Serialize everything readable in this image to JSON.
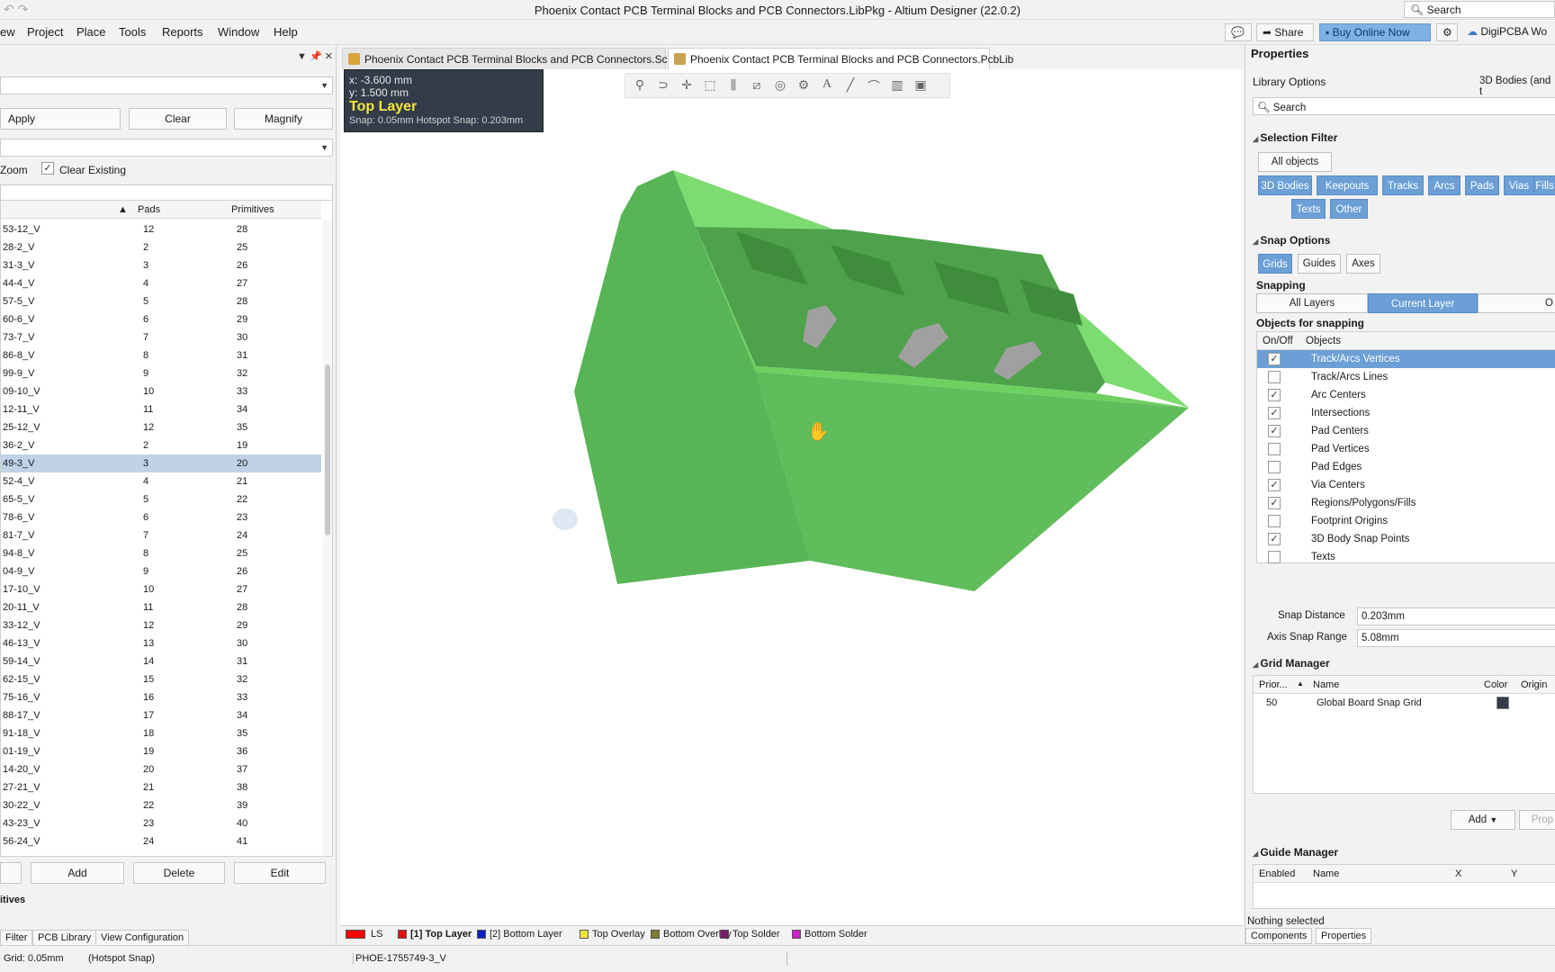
{
  "app": {
    "title": "Phoenix Contact PCB Terminal Blocks and PCB Connectors.LibPkg - Altium Designer (22.0.2)",
    "search_placeholder": "Search"
  },
  "menu": [
    "ew",
    "Project",
    "Place",
    "Tools",
    "Reports",
    "Window",
    "Help"
  ],
  "topbar": {
    "share": "Share",
    "buy": "Buy Online Now",
    "digipcba": "DigiPCBA Wo"
  },
  "left": {
    "apply": "Apply",
    "clear": "Clear",
    "magnify": "Magnify",
    "zoom": "Zoom",
    "clear_existing": "Clear Existing",
    "col_pads": "Pads",
    "col_primitives": "Primitives",
    "rows": [
      [
        "53-12_V",
        "12",
        "28"
      ],
      [
        "28-2_V",
        "2",
        "25"
      ],
      [
        "31-3_V",
        "3",
        "26"
      ],
      [
        "44-4_V",
        "4",
        "27"
      ],
      [
        "57-5_V",
        "5",
        "28"
      ],
      [
        "60-6_V",
        "6",
        "29"
      ],
      [
        "73-7_V",
        "7",
        "30"
      ],
      [
        "86-8_V",
        "8",
        "31"
      ],
      [
        "99-9_V",
        "9",
        "32"
      ],
      [
        "09-10_V",
        "10",
        "33"
      ],
      [
        "12-11_V",
        "11",
        "34"
      ],
      [
        "25-12_V",
        "12",
        "35"
      ],
      [
        "36-2_V",
        "2",
        "19"
      ],
      [
        "49-3_V",
        "3",
        "20"
      ],
      [
        "52-4_V",
        "4",
        "21"
      ],
      [
        "65-5_V",
        "5",
        "22"
      ],
      [
        "78-6_V",
        "6",
        "23"
      ],
      [
        "81-7_V",
        "7",
        "24"
      ],
      [
        "94-8_V",
        "8",
        "25"
      ],
      [
        "04-9_V",
        "9",
        "26"
      ],
      [
        "17-10_V",
        "10",
        "27"
      ],
      [
        "20-11_V",
        "11",
        "28"
      ],
      [
        "33-12_V",
        "12",
        "29"
      ],
      [
        "46-13_V",
        "13",
        "30"
      ],
      [
        "59-14_V",
        "14",
        "31"
      ],
      [
        "62-15_V",
        "15",
        "32"
      ],
      [
        "75-16_V",
        "16",
        "33"
      ],
      [
        "88-17_V",
        "17",
        "34"
      ],
      [
        "91-18_V",
        "18",
        "35"
      ],
      [
        "01-19_V",
        "19",
        "36"
      ],
      [
        "14-20_V",
        "20",
        "37"
      ],
      [
        "27-21_V",
        "21",
        "38"
      ],
      [
        "30-22_V",
        "22",
        "39"
      ],
      [
        "43-23_V",
        "23",
        "40"
      ],
      [
        "56-24_V",
        "24",
        "41"
      ]
    ],
    "selected_row": 13,
    "add": "Add",
    "delete": "Delete",
    "edit": "Edit",
    "primitives": "itives",
    "tabs": [
      "Filter",
      "PCB Library",
      "View Configuration"
    ]
  },
  "doc_tabs": [
    {
      "label": "Phoenix Contact PCB Terminal Blocks and PCB Connectors.SchLib",
      "icon_color": "#d9a53a"
    },
    {
      "label": "Phoenix Contact PCB Terminal Blocks and PCB Connectors.PcbLib",
      "icon_color": "#c8a050"
    }
  ],
  "hud": {
    "x": "x: -3.600 mm",
    "y": "y:  1.500 mm",
    "layer": "Top Layer",
    "snap": "Snap: 0.05mm Hotspot Snap: 0.203mm"
  },
  "layers": [
    {
      "label": "LS",
      "color": "#ff0000"
    },
    {
      "label": "[1] Top Layer",
      "color": "#e01010",
      "bold": true
    },
    {
      "label": "[2] Bottom Layer",
      "color": "#1020c8"
    },
    {
      "label": "Top Overlay",
      "color": "#f2e63c"
    },
    {
      "label": "Bottom Overlay",
      "color": "#807a30"
    },
    {
      "label": "Top Solder",
      "color": "#7a1a6a"
    },
    {
      "label": "Bottom Solder",
      "color": "#d020c8"
    }
  ],
  "right": {
    "title": "Properties",
    "library_options": "Library Options",
    "bodies_label": "3D Bodies (and t",
    "search_placeholder": "Search",
    "selection_filter": "Selection Filter",
    "all_objects": "All objects",
    "filter_chips": [
      "3D Bodies",
      "Keepouts",
      "Tracks",
      "Arcs",
      "Pads",
      "Vias",
      "Fills",
      "Texts",
      "Other"
    ],
    "snap_options": "Snap Options",
    "snap_buttons": [
      "Grids",
      "Guides",
      "Axes"
    ],
    "snapping": "Snapping",
    "snapping_tabs": [
      "All Layers",
      "Current Layer",
      "O"
    ],
    "objects_for_snapping": "Objects for snapping",
    "col_onoff": "On/Off",
    "col_objects": "Objects",
    "objects": [
      {
        "label": "Track/Arcs Vertices",
        "on": true
      },
      {
        "label": "Track/Arcs Lines",
        "on": false
      },
      {
        "label": "Arc Centers",
        "on": true
      },
      {
        "label": "Intersections",
        "on": true
      },
      {
        "label": "Pad Centers",
        "on": true
      },
      {
        "label": "Pad Vertices",
        "on": false
      },
      {
        "label": "Pad Edges",
        "on": false
      },
      {
        "label": "Via Centers",
        "on": true
      },
      {
        "label": "Regions/Polygons/Fills",
        "on": true
      },
      {
        "label": "Footprint Origins",
        "on": false
      },
      {
        "label": "3D Body Snap Points",
        "on": true
      },
      {
        "label": "Texts",
        "on": false
      }
    ],
    "snap_distance_label": "Snap Distance",
    "snap_distance": "0.203mm",
    "axis_snap_label": "Axis Snap Range",
    "axis_snap": "5.08mm",
    "grid_manager": "Grid Manager",
    "grid_cols": [
      "Prior...",
      "Name",
      "Color",
      "Origin"
    ],
    "grid_row": {
      "priority": "50",
      "name": "Global Board Snap Grid",
      "color": "#333a48"
    },
    "add_btn": "Add",
    "props_btn": "Prop",
    "guide_manager": "Guide Manager",
    "guide_cols": [
      "Enabled",
      "Name",
      "X",
      "Y"
    ],
    "nothing_selected": "Nothing selected",
    "tabs": [
      "Components",
      "Properties"
    ]
  },
  "status": {
    "grid": "Grid: 0.05mm",
    "hotspot": "(Hotspot Snap)",
    "component": "PHOE-1755749-3_V"
  }
}
